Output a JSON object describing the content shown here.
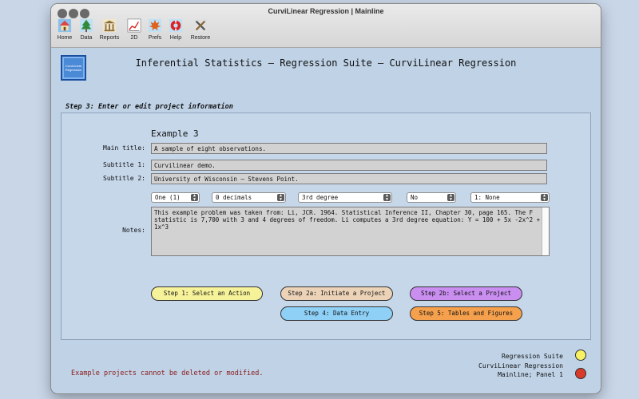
{
  "window": {
    "title": "CurviLinear Regression | Mainline"
  },
  "toolbar": {
    "items": [
      {
        "label": "Home",
        "icon": "house-icon"
      },
      {
        "label": "Data",
        "icon": "tree-icon"
      },
      {
        "label": "Reports",
        "icon": "building-icon"
      },
      {
        "label": "2D",
        "icon": "chart-icon"
      },
      {
        "label": "Prefs",
        "icon": "maple-leaf-icon"
      },
      {
        "label": "Help",
        "icon": "lifebuoy-icon"
      },
      {
        "label": "Restore",
        "icon": "tools-icon"
      }
    ]
  },
  "header": {
    "logo_text": "CurviLinear Regression",
    "title": "Inferential Statistics — Regression Suite — CurviLinear Regression"
  },
  "step_label": "Step 3: Enter or edit project information",
  "form": {
    "example_title": "Example 3",
    "main_title_label": "Main title:",
    "main_title_value": "A sample of eight observations.",
    "subtitle1_label": "Subtitle 1:",
    "subtitle1_value": "Curvilinear demo.",
    "subtitle2_label": "Subtitle 2:",
    "subtitle2_value": "University of Wisconsin – Stevens Point.",
    "selects": [
      {
        "value": "One (1)"
      },
      {
        "value": "0 decimals"
      },
      {
        "value": "3rd degree"
      },
      {
        "value": "No"
      },
      {
        "value": "1: None"
      }
    ],
    "notes_label": "Notes:",
    "notes_value": "This example problem was taken from: Li, JCR. 1964. Statistical Inference II, Chapter 30, page 165. The F statistic is 7,700 with 3 and 4 degrees of freedom. Li computes a 3rd degree equation: Y = 100 + 5x -2x^2 + 1x^3"
  },
  "buttons": {
    "step1": "Step 1: Select an Action",
    "step2a": "Step 2a: Initiate a Project",
    "step2b": "Step 2b: Select a Project",
    "step4": "Step 4: Data Entry",
    "step5": "Step 5: Tables and Figures"
  },
  "colors": {
    "step1": "#f6f29a",
    "step2a": "#ecd3b8",
    "step2b": "#c98ef0",
    "step4": "#8ed0f6",
    "step5": "#f5a04d",
    "status_yellow": "#f8f263",
    "status_red": "#d93a2a"
  },
  "status": {
    "line1": "Regression Suite",
    "line2": "CurviLinear Regression",
    "line3": "Mainline; Panel 1"
  },
  "footer_message": "Example projects cannot be deleted or modified."
}
